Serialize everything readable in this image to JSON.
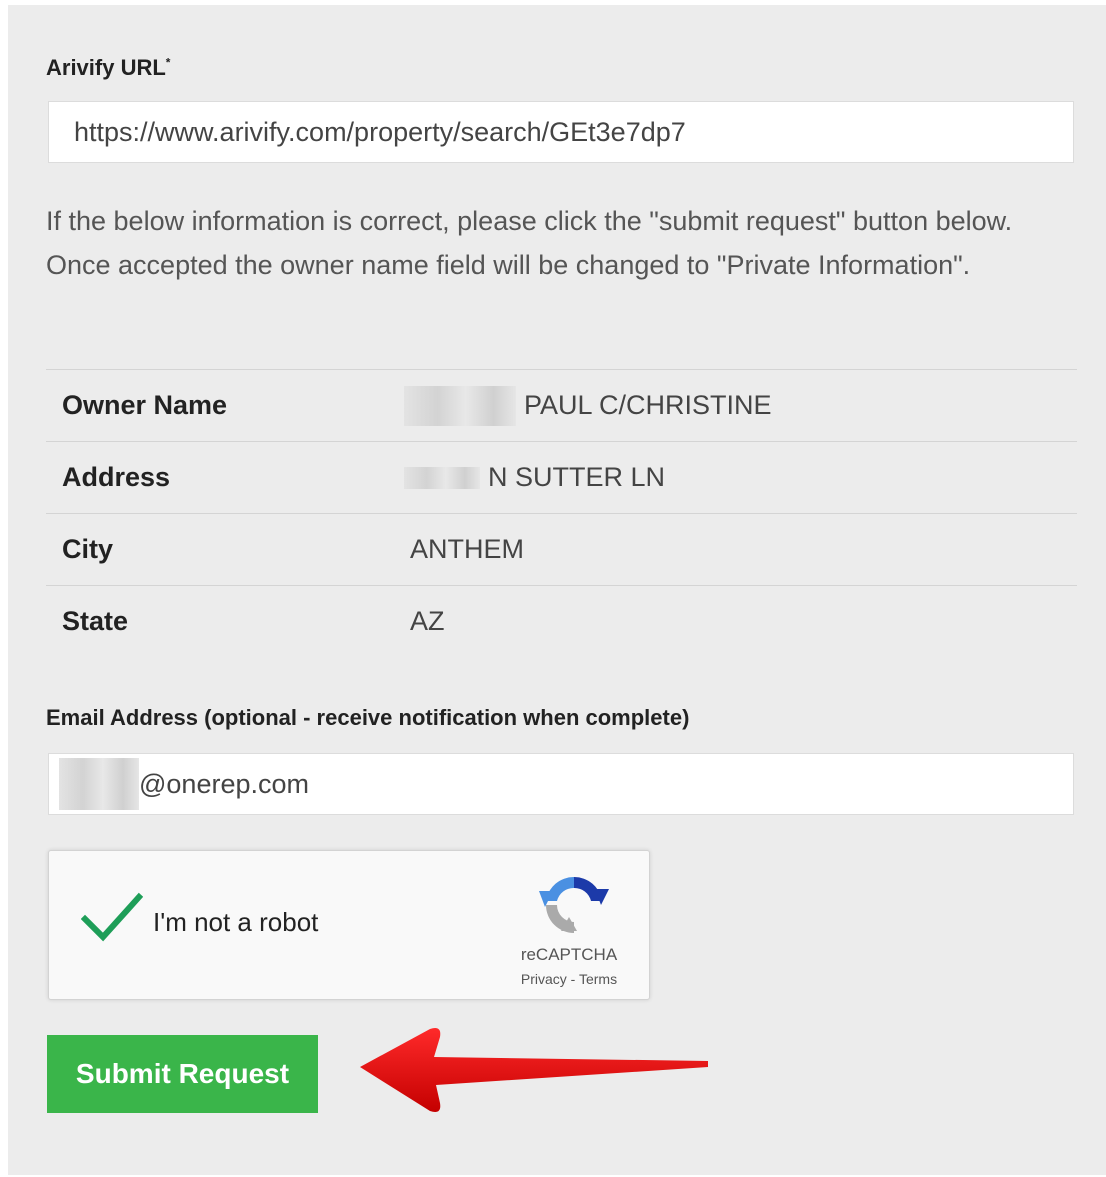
{
  "url_section": {
    "label": "Arivify URL",
    "required_mark": "*",
    "value": "https://www.arivify.com/property/search/GEt3e7dp7"
  },
  "intro_text": "If the below information is correct, please click the \"submit request\" button below. Once accepted the owner name field will be changed to \"Private Information\".",
  "property_info": [
    {
      "label": "Owner Name",
      "value": "PAUL C/CHRISTINE",
      "redacted_prefix": true
    },
    {
      "label": "Address",
      "value": "N SUTTER LN",
      "redacted_prefix": true
    },
    {
      "label": "City",
      "value": "ANTHEM",
      "redacted_prefix": false
    },
    {
      "label": "State",
      "value": "AZ",
      "redacted_prefix": false
    }
  ],
  "email_section": {
    "label": "Email Address (optional - receive notification when complete)",
    "value": "@onerep.com"
  },
  "captcha": {
    "checkbox_label": "I'm not a robot",
    "brand": "reCAPTCHA",
    "privacy": "Privacy",
    "separator": " - ",
    "terms": "Terms",
    "checked": true
  },
  "submit_button": {
    "label": "Submit Request",
    "color": "#3ab54a"
  },
  "annotation": {
    "icon": "red-arrow-icon",
    "color": "#e60000"
  }
}
